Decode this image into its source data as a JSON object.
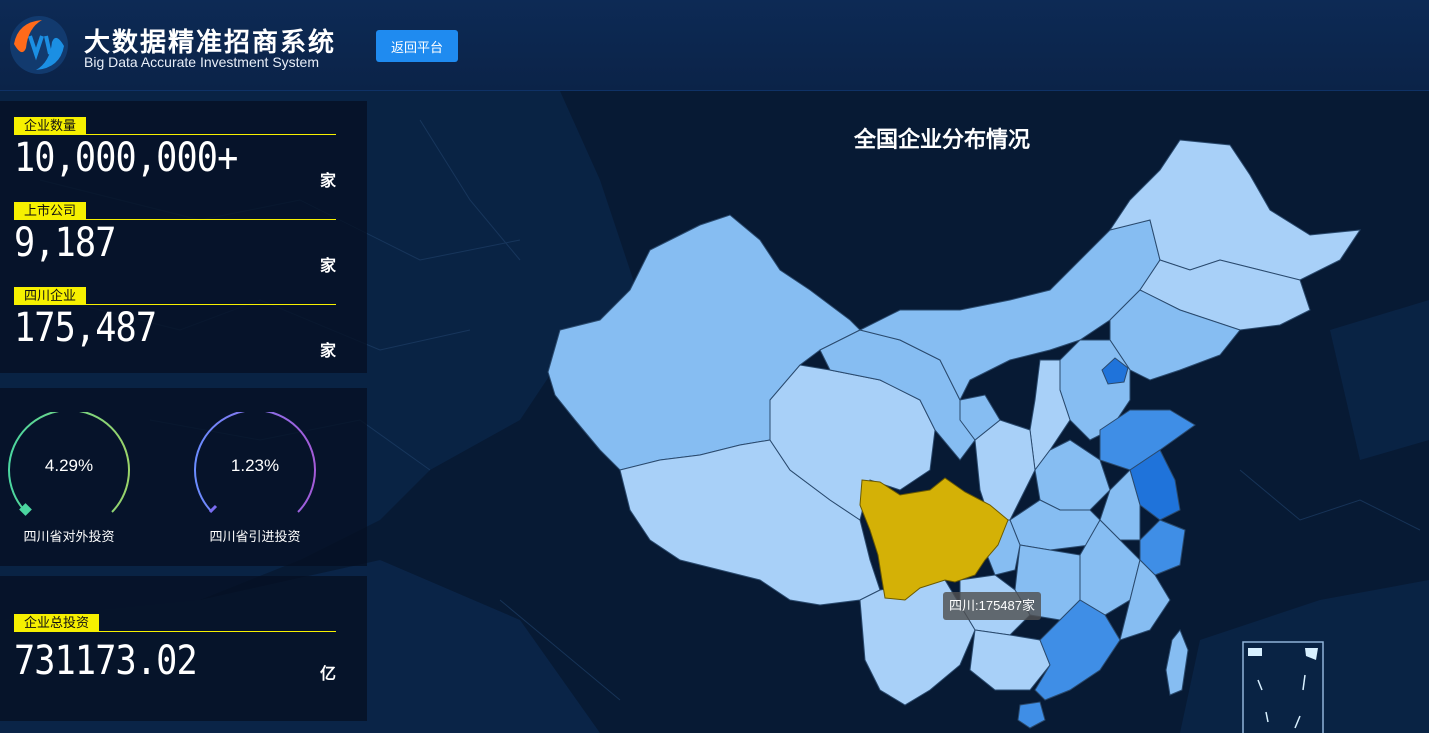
{
  "header": {
    "title": "大数据精准招商系统",
    "subtitle": "Big Data Accurate Investment System",
    "back_button": "返回平台"
  },
  "stats": [
    {
      "label": "企业数量",
      "value": "10,000,000+",
      "unit": "家"
    },
    {
      "label": "上市公司",
      "value": "9,187",
      "unit": "家"
    },
    {
      "label": "四川企业",
      "value": "175,487",
      "unit": "家"
    }
  ],
  "gauges": [
    {
      "value_text": "4.29%",
      "value": 4.29,
      "label": "四川省对外投资",
      "color_start": "#4bd6a0",
      "color_end": "#9ad36a"
    },
    {
      "value_text": "1.23%",
      "value": 1.23,
      "label": "四川省引进投资",
      "color_start": "#6a8cff",
      "color_end": "#a35bd8"
    }
  ],
  "total_investment": {
    "label": "企业总投资",
    "value": "731173.02",
    "unit": "亿"
  },
  "map": {
    "title": "全国企业分布情况",
    "tooltip": "四川:175487家",
    "highlight_color": "#d4b106",
    "colors": {
      "light": "#a8d0f8",
      "mid": "#86bdf2",
      "dark": "#3f8ee6",
      "deep": "#1f73da"
    }
  }
}
